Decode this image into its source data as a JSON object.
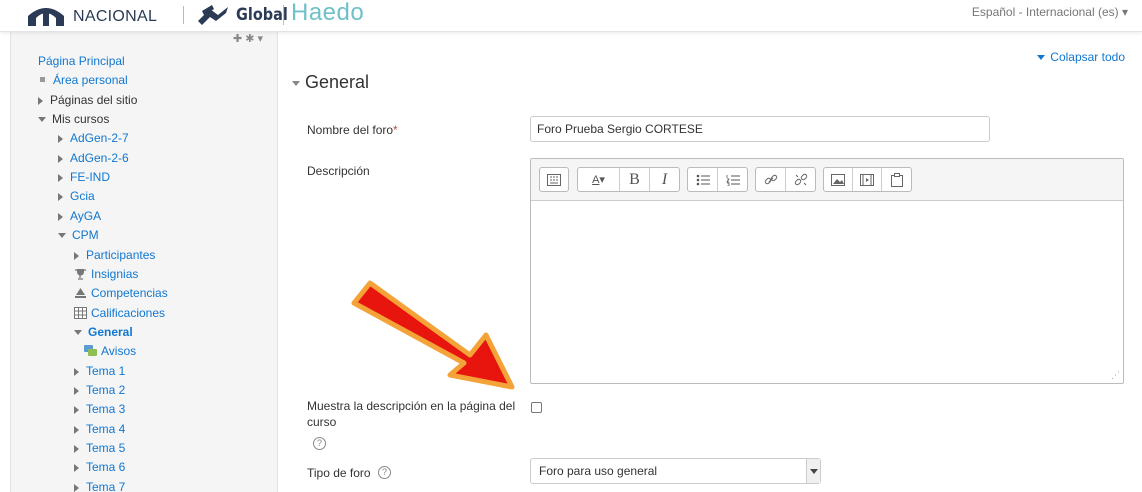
{
  "header": {
    "brand": "NACIONAL",
    "global_label": "Global",
    "site_name": "Haedo",
    "language": "Español - Internacional (es) ▾"
  },
  "sidebar": {
    "icons": "✚ ✱ ▾",
    "items": [
      {
        "label": "Página Principal",
        "marker": "none",
        "level": 0,
        "link": true
      },
      {
        "label": "Área personal",
        "marker": "bullet",
        "level": 0,
        "link": true
      },
      {
        "label": "Páginas del sitio",
        "marker": "right",
        "level": 0,
        "link": false
      },
      {
        "label": "Mis cursos",
        "marker": "down",
        "level": 0,
        "link": false
      },
      {
        "label": "AdGen-2-7",
        "marker": "right",
        "level": 1,
        "link": true
      },
      {
        "label": "AdGen-2-6",
        "marker": "right",
        "level": 1,
        "link": true
      },
      {
        "label": "FE-IND",
        "marker": "right",
        "level": 1,
        "link": true
      },
      {
        "label": "Gcia",
        "marker": "right",
        "level": 1,
        "link": true
      },
      {
        "label": "AyGA",
        "marker": "right",
        "level": 1,
        "link": true
      },
      {
        "label": "CPM",
        "marker": "down",
        "level": 1,
        "link": true
      },
      {
        "label": "Participantes",
        "marker": "right",
        "level": 2,
        "link": true
      },
      {
        "label": "Insignias",
        "marker": "trophy-icon",
        "level": 2,
        "link": true
      },
      {
        "label": "Competencias",
        "marker": "competencies-icon",
        "level": 2,
        "link": true
      },
      {
        "label": "Calificaciones",
        "marker": "grades-icon",
        "level": 2,
        "link": true
      },
      {
        "label": "General",
        "marker": "down",
        "level": 2,
        "link": true,
        "bold": true
      },
      {
        "label": "Avisos",
        "marker": "forum-icon",
        "level": 3,
        "link": true
      },
      {
        "label": "Tema 1",
        "marker": "right",
        "level": 2,
        "link": true
      },
      {
        "label": "Tema 2",
        "marker": "right",
        "level": 2,
        "link": true
      },
      {
        "label": "Tema 3",
        "marker": "right",
        "level": 2,
        "link": true
      },
      {
        "label": "Tema 4",
        "marker": "right",
        "level": 2,
        "link": true
      },
      {
        "label": "Tema 5",
        "marker": "right",
        "level": 2,
        "link": true
      },
      {
        "label": "Tema 6",
        "marker": "right",
        "level": 2,
        "link": true
      },
      {
        "label": "Tema 7",
        "marker": "right",
        "level": 2,
        "link": true
      }
    ]
  },
  "main": {
    "collapse_all": "Colapsar todo",
    "section_title": "General",
    "forum_name_label": "Nombre del foro",
    "required_mark": "*",
    "forum_name_value": "Foro Prueba Sergio CORTESE",
    "description_label": "Descripción",
    "show_description_label": "Muestra la descripción en la página del curso",
    "forum_type_label": "Tipo de foro",
    "forum_type_value": "Foro para uso general",
    "help_glyph": "?"
  },
  "toolbar": {
    "bold": "B",
    "italic": "I",
    "font_style": "A"
  },
  "colors": {
    "link": "#1177d1",
    "required": "#b94a48",
    "arrow_fill": "#e8140e",
    "arrow_border": "#f4a338",
    "haedo": "#6fc0c9"
  }
}
